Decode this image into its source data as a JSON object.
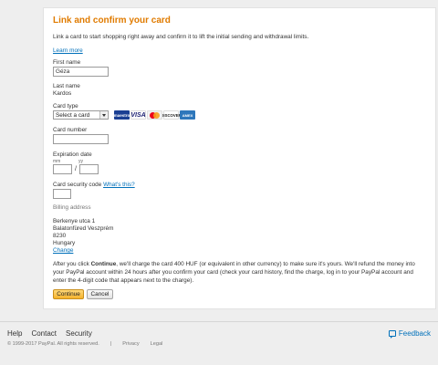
{
  "form": {
    "title": "Link and confirm your card",
    "intro": "Link a card to start shopping right away and confirm it to lift the initial sending and withdrawal limits.",
    "learn_more": "Learn more",
    "first_name_label": "First name",
    "first_name_value": "Géza",
    "last_name_label": "Last name",
    "last_name_value": "Kardos",
    "card_type_label": "Card type",
    "card_type_selected": "Select a card",
    "card_logos": [
      "maestro",
      "VISA",
      "mastercard",
      "DISCOVER",
      "AMEX"
    ],
    "card_number_label": "Card number",
    "expiration_label": "Expiration date",
    "mm_hint": "mm",
    "yy_hint": "yy",
    "date_sep": "/",
    "security_label": "Card security code",
    "whats_this": "What's this?",
    "billing_label": "Billing address",
    "address_lines": [
      "Berkenye utca 1",
      "Balatonfüred  Veszprém",
      "8230",
      "Hungary"
    ],
    "change_link": "Change",
    "notice_before": "After you click ",
    "notice_bold": "Continue",
    "notice_after": ", we'll charge the card 400 HUF (or equivalent in other currency) to make sure it's yours. We'll refund the money into your PayPal account within 24 hours after you confirm your card (check your card history, find the charge, log in to your PayPal account and enter the 4-digit code that appears next to the charge).",
    "continue_button": "Continue",
    "cancel_button": "Cancel"
  },
  "footer": {
    "links": [
      "Help",
      "Contact",
      "Security"
    ],
    "copyright": "© 1999-2017 PayPal. All rights reserved.",
    "separator": "|",
    "legal_links": [
      "Privacy",
      "Legal"
    ],
    "feedback": "Feedback"
  }
}
